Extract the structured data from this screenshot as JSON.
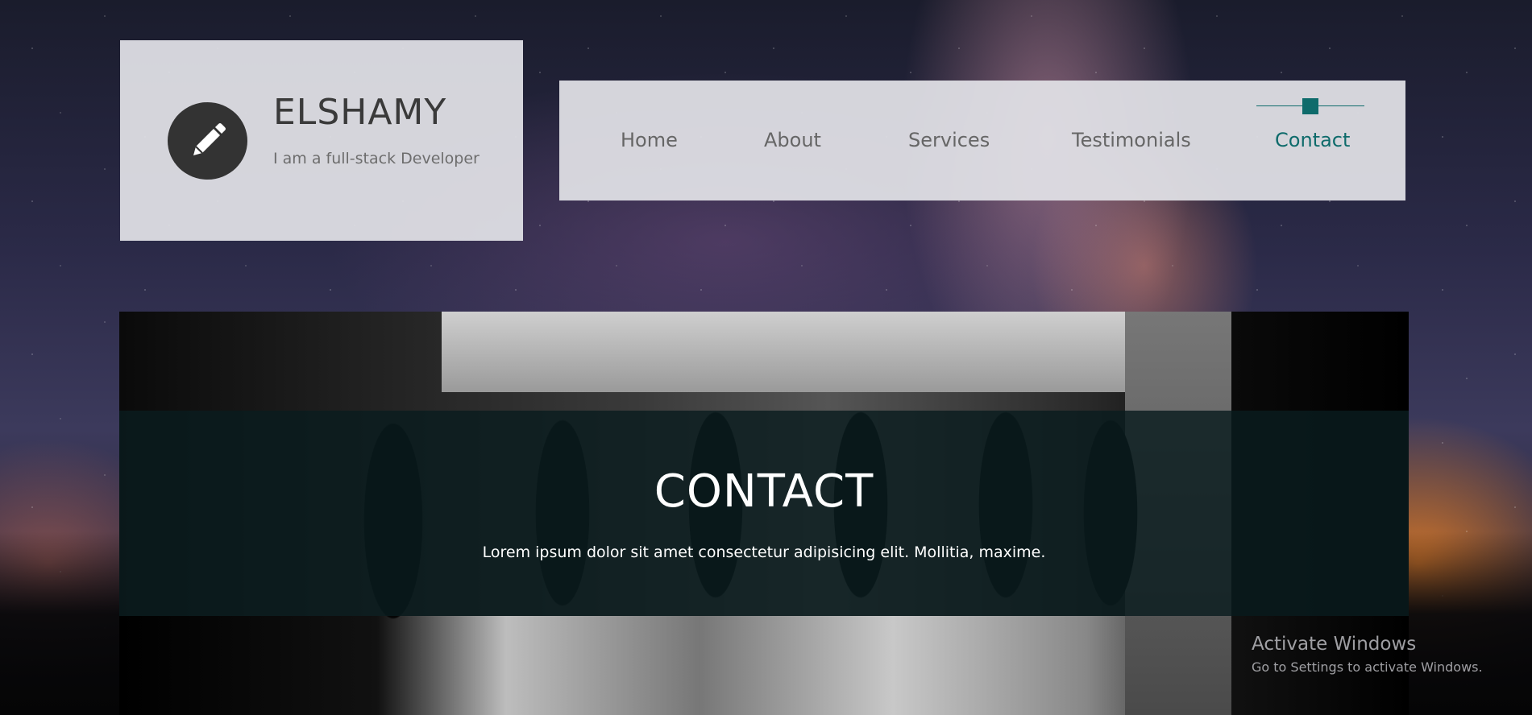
{
  "brand": {
    "name": "ELSHAMY",
    "tagline": "I am a full-stack Developer",
    "logo_icon": "pencil-icon"
  },
  "nav": {
    "items": [
      {
        "label": "Home"
      },
      {
        "label": "About"
      },
      {
        "label": "Services"
      },
      {
        "label": "Testimonials"
      },
      {
        "label": "Contact"
      }
    ],
    "active": "Contact"
  },
  "hero": {
    "title": "CONTACT",
    "text": "Lorem ipsum dolor sit amet consectetur adipisicing elit. Mollitia, maxime."
  },
  "watermark": {
    "title": "Activate Windows",
    "subtitle": "Go to Settings to activate Windows."
  },
  "colors": {
    "accent": "#0e6b6b",
    "card_bg": "#e0e0e6",
    "logo_bg": "#333333"
  }
}
